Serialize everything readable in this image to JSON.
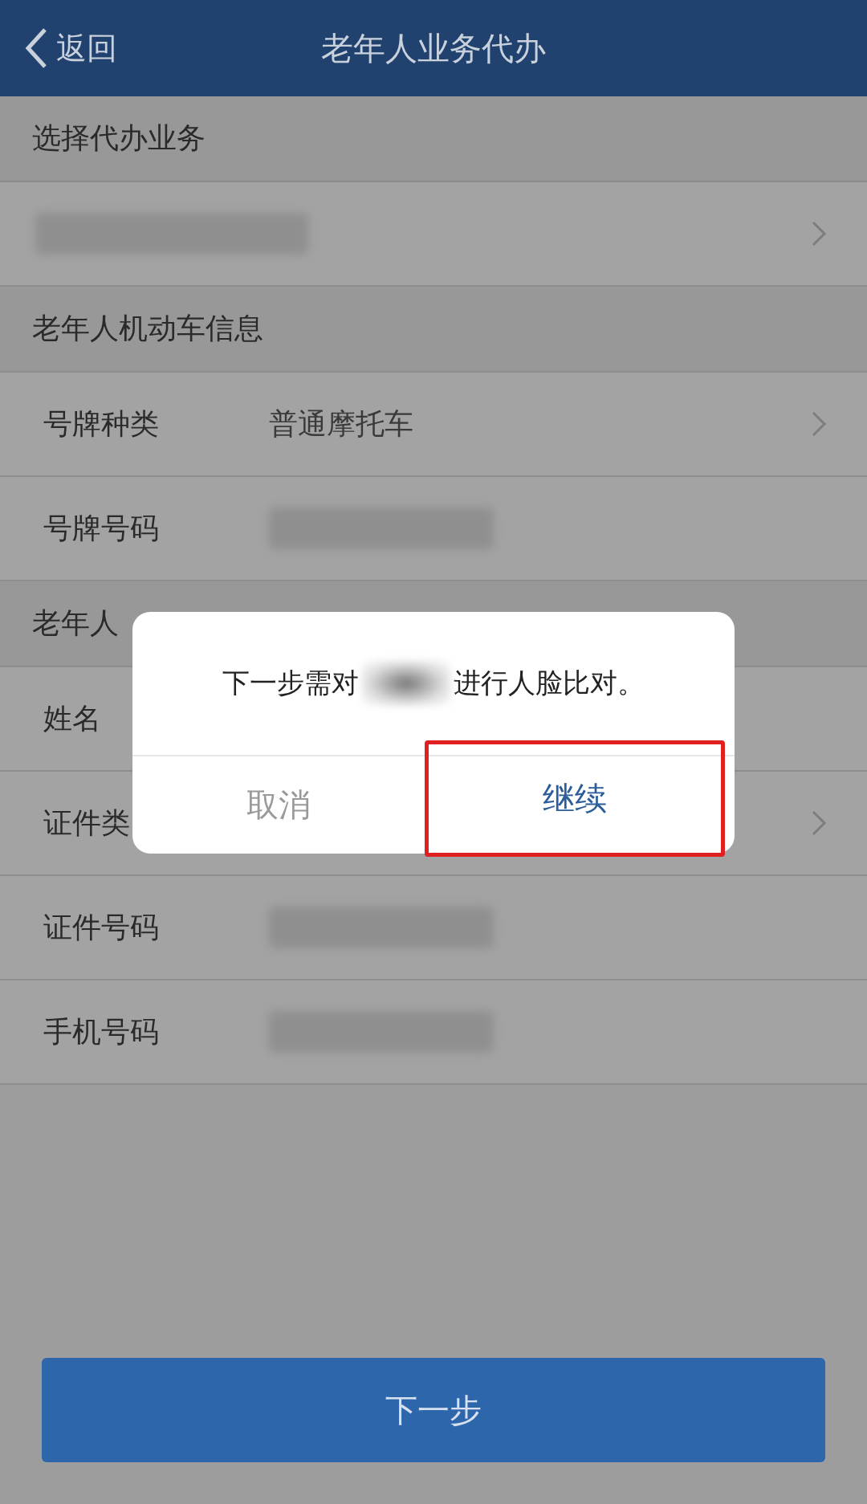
{
  "header": {
    "back_label": "返回",
    "title": "老年人业务代办"
  },
  "sections": [
    {
      "title": "选择代办业务",
      "rows": [
        {
          "kind": "blurred",
          "chevron": true
        }
      ]
    },
    {
      "title": "老年人机动车信息",
      "rows": [
        {
          "kind": "text",
          "label": "号牌种类",
          "value": "普通摩托车",
          "chevron": true
        },
        {
          "kind": "blurred",
          "label": "号牌号码",
          "chevron": false
        }
      ]
    },
    {
      "title": "老年人",
      "rows": [
        {
          "kind": "empty",
          "label": "姓名",
          "chevron": false
        },
        {
          "kind": "empty",
          "label": "证件类",
          "chevron": true
        },
        {
          "kind": "blurred",
          "label": "证件号码",
          "chevron": false
        },
        {
          "kind": "blurred",
          "label": "手机号码",
          "chevron": false
        }
      ]
    }
  ],
  "next_button": "下一步",
  "dialog": {
    "message_before": "下一步需对",
    "message_after": "进行人脸比对。",
    "buttons": [
      {
        "label": "取消",
        "highlighted": false
      },
      {
        "label": "继续",
        "highlighted": true
      }
    ]
  }
}
